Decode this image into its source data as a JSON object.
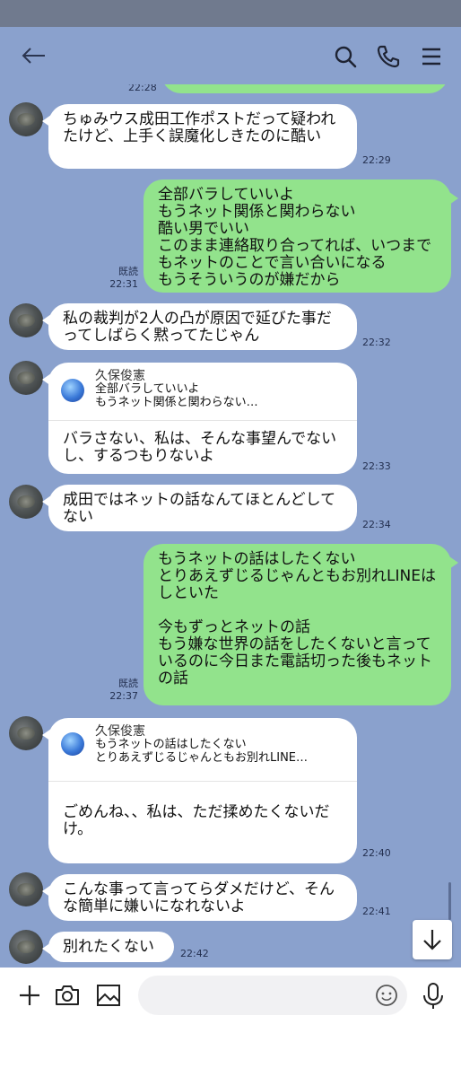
{
  "header": {
    "back_icon": "back-arrow-icon",
    "icons": [
      "search-icon",
      "phone-icon",
      "menu-icon"
    ]
  },
  "messages": [
    {
      "id": "m0",
      "side": "out",
      "time": "22:28"
    },
    {
      "id": "m1",
      "side": "in",
      "text": "ちゅみウス成田工作ポストだって疑われたけど、上手く誤魔化しきたのに酷い",
      "time": "22:29"
    },
    {
      "id": "m2",
      "side": "out",
      "read": "既読",
      "time": "22:31",
      "text": "全部バラしていいよ\nもうネット関係と関わらない\n酷い男でいい\nこのまま連絡取り合ってれば、いつまでもネットのことで言い合いになる\nもうそういうのが嫌だから"
    },
    {
      "id": "m3",
      "side": "in",
      "text": "私の裁判が2人の凸が原因で延びた事だってしばらく黙ってたじゃん",
      "time": "22:32"
    },
    {
      "id": "m4",
      "side": "in",
      "quote_name": "久保俊憲",
      "quote_text": "全部バラしていいよ\nもうネット関係と関わらない…",
      "text": "バラさない、私は、そんな事望んでないし、するつもりないよ",
      "time": "22:33"
    },
    {
      "id": "m5",
      "side": "in",
      "text": "成田ではネットの話なんてほとんどしてない",
      "time": "22:34"
    },
    {
      "id": "m6",
      "side": "out",
      "read": "既読",
      "time": "22:37",
      "text": "もうネットの話はしたくない\nとりあえずじるじゃんともお別れLINEはしといた\n\n今もずっとネットの話\nもう嫌な世界の話をしたくないと言っているのに今日また電話切った後もネットの話"
    },
    {
      "id": "m7",
      "side": "in",
      "quote_name": "久保俊憲",
      "quote_text": "もうネットの話はしたくない\nとりあえずじるじゃんともお別れLINE…",
      "text": "ごめんね、、私は、ただ揉めたくないだけ。",
      "time": "22:40"
    },
    {
      "id": "m8",
      "side": "in",
      "text": "こんな事って言ってらダメだけど、そんな簡単に嫌いになれないよ",
      "time": "22:41"
    },
    {
      "id": "m9",
      "side": "in",
      "text": "別れたくない",
      "time": "22:42"
    }
  ],
  "bottombar": {
    "icons": [
      "plus-icon",
      "camera-icon",
      "image-icon",
      "emoji-icon",
      "mic-icon"
    ],
    "input_placeholder": ""
  },
  "scroll_button_icon": "arrow-down-icon",
  "colors": {
    "background": "#8aa1cd",
    "outgoing_bubble": "#92e38c",
    "incoming_bubble": "#ffffff"
  }
}
